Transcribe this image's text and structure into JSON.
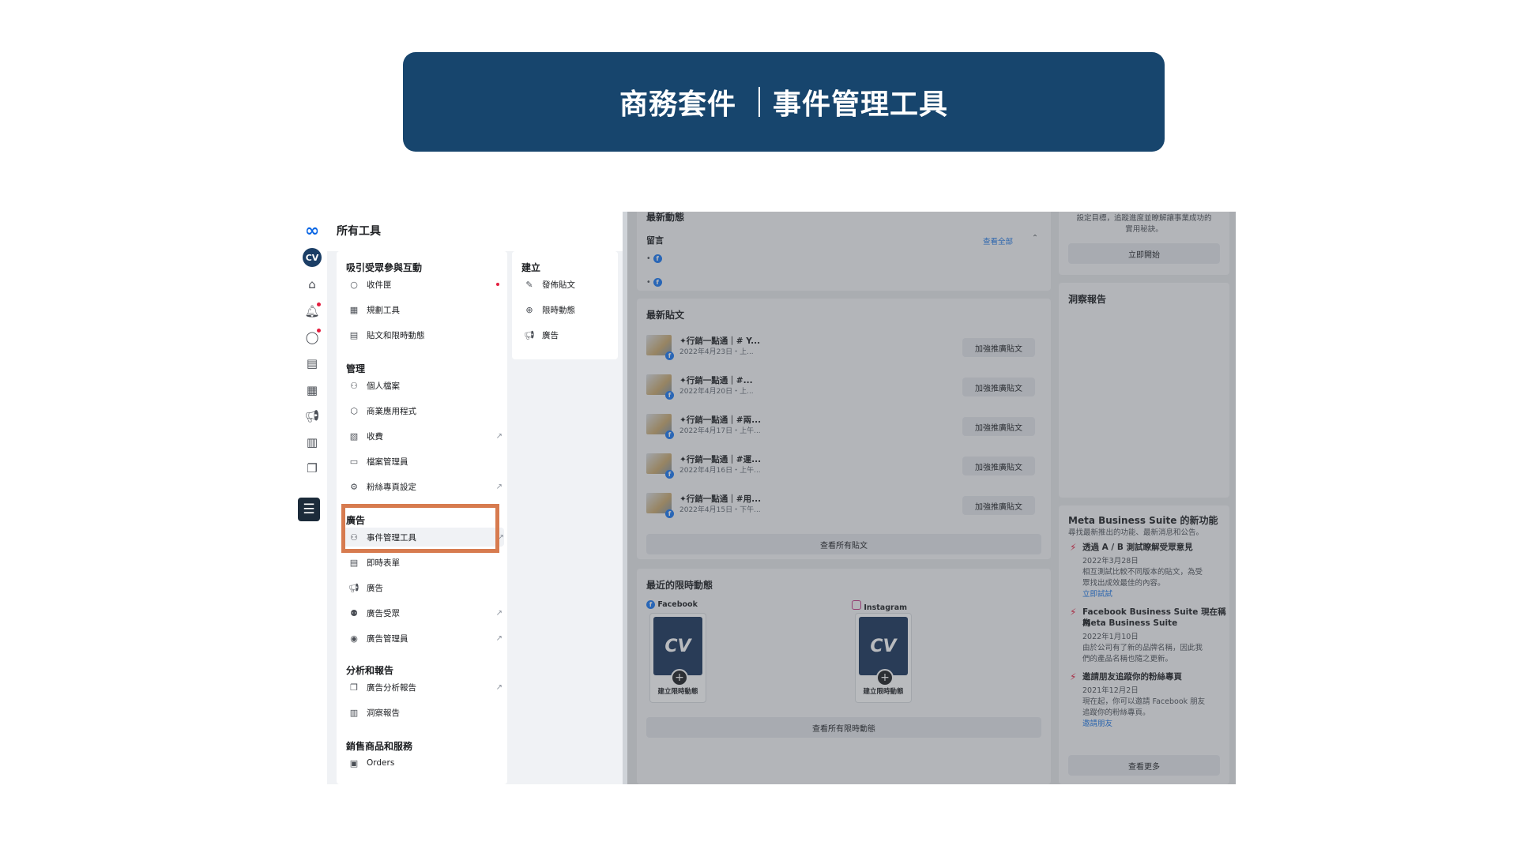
{
  "banner": {
    "left": "商務套件",
    "right": "事件管理工具"
  },
  "rail": {
    "brand_initials": "CV"
  },
  "tools": {
    "title": "所有工具",
    "engage": {
      "heading": "吸引受眾參與互動",
      "items": [
        "收件匣",
        "規劃工具",
        "貼文和限時動態"
      ]
    },
    "manage": {
      "heading": "管理",
      "items": [
        "個人檔案",
        "商業應用程式",
        "收費",
        "檔案管理員",
        "粉絲專頁設定"
      ]
    },
    "ads": {
      "heading": "廣告",
      "items": [
        "事件管理工具",
        "即時表單",
        "廣告",
        "廣告受眾",
        "廣告管理員"
      ]
    },
    "analytics": {
      "heading": "分析和報告",
      "items": [
        "廣告分析報告",
        "洞察報告"
      ]
    },
    "sell": {
      "heading": "銷售商品和服務",
      "items": [
        "Orders"
      ]
    },
    "create": {
      "heading": "建立",
      "items": [
        "發佈貼文",
        "限時動態",
        "廣告"
      ]
    }
  },
  "main": {
    "activity": {
      "title": "最新動態",
      "comments_label": "留言",
      "view_all": "查看全部"
    },
    "posts": {
      "title": "最新貼文",
      "boost_label": "加強推廣貼文",
      "view_all": "查看所有貼文",
      "items": [
        {
          "title": "✦行銷一點通｜# Y...",
          "date": "2022年4月23日・上..."
        },
        {
          "title": "✦行銷一點通｜#...",
          "date": "2022年4月20日・上..."
        },
        {
          "title": "✦行銷一點通｜#兩...",
          "date": "2022年4月17日・上午..."
        },
        {
          "title": "✦行銷一點通｜#運...",
          "date": "2022年4月16日・上午..."
        },
        {
          "title": "✦行銷一點通｜#用...",
          "date": "2022年4月15日・下午..."
        }
      ]
    },
    "stories": {
      "title": "最近的限時動態",
      "facebook_label": "Facebook",
      "instagram_label": "Instagram",
      "create_label": "建立限時動態",
      "view_all": "查看所有限時動態"
    },
    "goals": {
      "text_line1": "設定目標，追蹤進度並瞭解讓事業成功的",
      "text_line2": "實用秘訣。",
      "start_button": "立即開始"
    },
    "insights": {
      "title": "洞察報告"
    },
    "news": {
      "title": "Meta Business Suite 的新功能",
      "subtitle": "尋找最新推出的功能、最新消息和公告。",
      "items": [
        {
          "title": "透過 A / B 測試瞭解受眾意見",
          "date": "2022年3月28日",
          "body_line1": "相互測試比較不同版本的貼文，為受",
          "body_line2": "眾找出成效最佳的內容。",
          "link": "立即試試"
        },
        {
          "title_line1": "Facebook Business Suite 現在稱為",
          "title_line2": "Meta Business Suite",
          "date": "2022年1月10日",
          "body_line1": "由於公司有了新的品牌名稱，因此我",
          "body_line2": "們的產品名稱也隨之更新。"
        },
        {
          "title": "邀請朋友追蹤你的粉絲專頁",
          "date": "2021年12月2日",
          "body_line1": "現在起，你可以邀請 Facebook 朋友",
          "body_line2": "追蹤你的粉絲專頁。",
          "link": "邀請朋友"
        }
      ],
      "more_button": "查看更多"
    }
  }
}
